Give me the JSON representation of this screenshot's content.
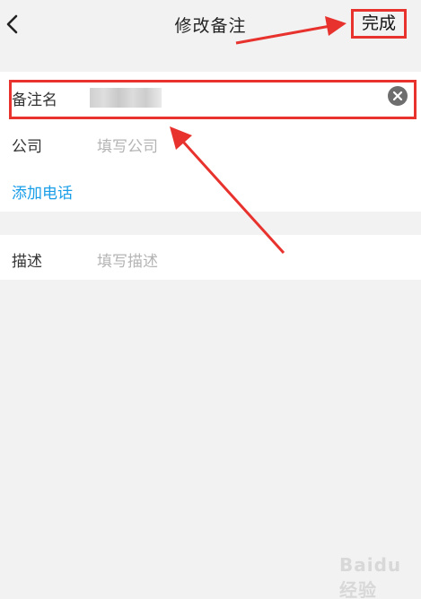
{
  "header": {
    "title": "修改备注",
    "done_label": "完成"
  },
  "form": {
    "alias": {
      "label": "备注名"
    },
    "company": {
      "label": "公司",
      "placeholder": "填写公司"
    },
    "add_phone_label": "添加电话",
    "description": {
      "label": "描述",
      "placeholder": "填写描述"
    }
  },
  "annotations": {
    "highlight_color": "#e8322e"
  },
  "watermark": {
    "text": "Baidu 经验"
  },
  "colors": {
    "background": "#f2f2f2",
    "link": "#1a9ee8",
    "placeholder": "#b4b4b4"
  },
  "icons": [
    "chevron-left-icon",
    "clear-circle-icon"
  ]
}
